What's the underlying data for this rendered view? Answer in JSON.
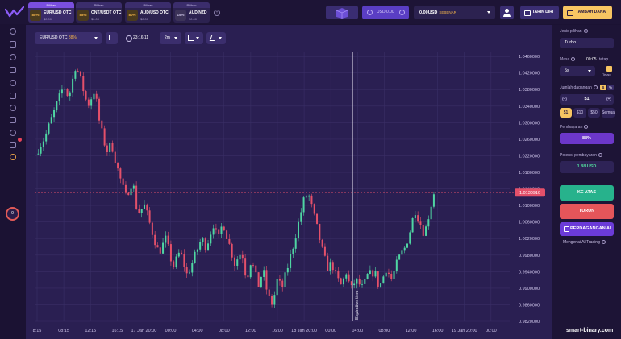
{
  "topbar": {
    "tabs": [
      {
        "header": "Pilihan",
        "payout": "88%",
        "name": "EUR/USD OTC",
        "amount": "$0.00",
        "active": true
      },
      {
        "header": "Pilihan",
        "payout": "88%",
        "name": "QNT/USDT OTC",
        "amount": "$0.00",
        "active": false
      },
      {
        "header": "Pilihan",
        "payout": "80%",
        "name": "AUD/USD OTC",
        "amount": "$0.00",
        "active": false
      },
      {
        "header": "Pilihan",
        "payout": "15%",
        "name": "AUD/NZD",
        "amount": "$0.00",
        "active": false
      }
    ],
    "add_tab": "+",
    "demo_balance": "USD 0.00",
    "balance_amount": "0.00USD",
    "balance_type": "SEBENAR",
    "withdraw_label": "TARIK DIRI",
    "deposit_label": "TAMBAH DANA"
  },
  "chart_toolbar": {
    "pair": "EUR/USD OTC",
    "pair_payout": "88%",
    "time": "23:16:11",
    "timeframe": "2m"
  },
  "chart_data": {
    "type": "candlestick",
    "symbol": "EUR/USD OTC",
    "current_price": "1.0130910",
    "marker_label": "Expiration time",
    "y_ticks": [
      "1.0460000",
      "1.0420000",
      "1.0380000",
      "1.0340000",
      "1.0300000",
      "1.0260000",
      "1.0220000",
      "1.0180000",
      "1.0140000",
      "1.0100000",
      "1.0060000",
      "1.0020000",
      "0.9980000",
      "0.9940000",
      "0.9900000",
      "0.9860000",
      "0.9820000"
    ],
    "x_ticks": [
      "8:15",
      "08:15",
      "12:15",
      "16:15",
      "17 Jan 20:00",
      "00:00",
      "04:00",
      "08:00",
      "12:00",
      "16:00",
      "18 Jan 20:00",
      "00:00",
      "04:00",
      "08:00",
      "12:00",
      "16:00",
      "19 Jan 20:00",
      "00:00"
    ],
    "ylim": [
      0.982,
      1.047
    ],
    "close_path": [
      [
        0.0,
        1.0225
      ],
      [
        0.02,
        1.0265
      ],
      [
        0.04,
        1.033
      ],
      [
        0.06,
        1.039
      ],
      [
        0.07,
        1.036
      ],
      [
        0.085,
        1.044
      ],
      [
        0.095,
        1.0405
      ],
      [
        0.11,
        1.034
      ],
      [
        0.125,
        1.038
      ],
      [
        0.135,
        1.03
      ],
      [
        0.15,
        1.023
      ],
      [
        0.16,
        1.025
      ],
      [
        0.175,
        1.018
      ],
      [
        0.19,
        1.012
      ],
      [
        0.205,
        1.016
      ],
      [
        0.215,
        1.008
      ],
      [
        0.23,
        1.01
      ],
      [
        0.245,
        1.004
      ],
      [
        0.26,
        0.9985
      ],
      [
        0.275,
        1.002
      ],
      [
        0.29,
        0.995
      ],
      [
        0.305,
        0.999
      ],
      [
        0.32,
        0.993
      ],
      [
        0.335,
        0.9975
      ],
      [
        0.35,
        1.002
      ],
      [
        0.36,
        1.0
      ],
      [
        0.375,
        1.0055
      ],
      [
        0.385,
        1.0015
      ],
      [
        0.395,
        1.006
      ],
      [
        0.41,
        1.0
      ],
      [
        0.42,
        0.996
      ],
      [
        0.435,
        0.999
      ],
      [
        0.445,
        0.992
      ],
      [
        0.455,
        0.997
      ],
      [
        0.47,
        0.9905
      ],
      [
        0.48,
        0.9945
      ],
      [
        0.49,
        0.988
      ],
      [
        0.5,
        0.986
      ],
      [
        0.51,
        0.992
      ],
      [
        0.52,
        0.99
      ],
      [
        0.535,
        0.9965
      ],
      [
        0.545,
        1.001
      ],
      [
        0.555,
        1.006
      ],
      [
        0.565,
        1.011
      ],
      [
        0.575,
        1.013
      ],
      [
        0.585,
        1.0085
      ],
      [
        0.595,
        1.004
      ],
      [
        0.605,
        0.999
      ],
      [
        0.615,
        0.995
      ],
      [
        0.625,
        0.996
      ],
      [
        0.635,
        0.9925
      ],
      [
        0.645,
        0.9905
      ],
      [
        0.655,
        0.994
      ],
      [
        0.665,
        0.9895
      ],
      [
        0.675,
        0.992
      ],
      [
        0.69,
        0.99
      ],
      [
        0.7,
        0.993
      ],
      [
        0.715,
        0.994
      ],
      [
        0.725,
        0.99
      ],
      [
        0.74,
        0.995
      ],
      [
        0.75,
        0.992
      ],
      [
        0.765,
        0.997
      ],
      [
        0.78,
        1.0
      ],
      [
        0.79,
        1.004
      ],
      [
        0.8,
        1.009
      ],
      [
        0.81,
        1.006
      ],
      [
        0.82,
        1.003
      ],
      [
        0.83,
        1.008
      ],
      [
        0.84,
        1.0131
      ]
    ]
  },
  "right_panel": {
    "option_type_label": "Jenis pilihan",
    "option_type": "Turbo",
    "duration_label": "Masa",
    "duration_clock": "00:05",
    "duration_fixed": "tetap",
    "duration_value": "5s",
    "fixed_label": "Tetap",
    "amount_label": "Jumlah dagangan",
    "toggle_dollar": "$",
    "toggle_percent": "%",
    "amount_value": "$1",
    "amount_minus": "−",
    "amount_plus": "+",
    "quick_amounts": [
      "$1",
      "$10",
      "$50",
      "Semua"
    ],
    "payout_label": "Pembayaran",
    "payout_value": "88%",
    "profit_label": "Potensi pembayaran",
    "profit_value": "1.88 USD",
    "up_label": "KE ATAS",
    "down_label": "TURUN",
    "ai_label": "PERDAGANGAN AI",
    "ai_info": "Mengenai AI Trading"
  },
  "sidebar": {
    "level": "0"
  },
  "watermark": "smart-binary.com"
}
